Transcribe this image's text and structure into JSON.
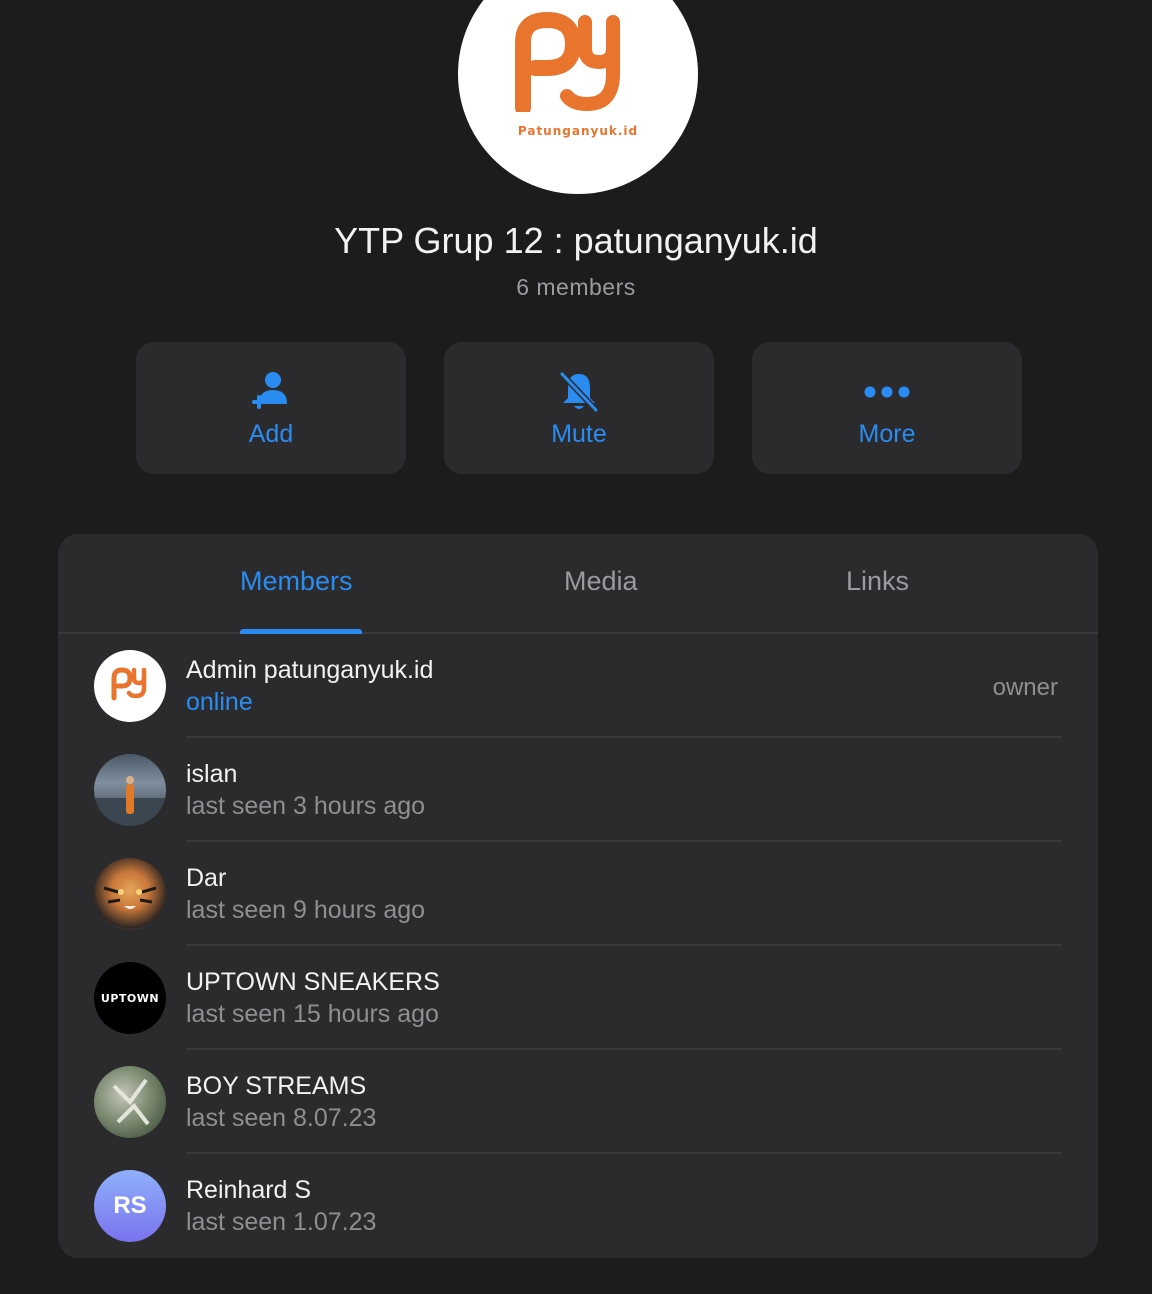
{
  "group": {
    "logo_text": "Patunganyuk.id",
    "title": "YTP Grup 12 : patunganyuk.id",
    "subtitle": "6 members"
  },
  "actions": {
    "add": {
      "label": "Add",
      "icon": "add-person-icon"
    },
    "mute": {
      "label": "Mute",
      "icon": "bell-slash-icon"
    },
    "more": {
      "label": "More",
      "icon": "ellipsis-icon"
    }
  },
  "tabs": [
    {
      "label": "Members",
      "active": true
    },
    {
      "label": "Media",
      "active": false
    },
    {
      "label": "Links",
      "active": false
    }
  ],
  "members": [
    {
      "name": "Admin patunganyuk.id",
      "status": "online",
      "role": "owner"
    },
    {
      "name": "islan",
      "status": "last seen 3 hours ago"
    },
    {
      "name": "Dar",
      "status": "last seen 9 hours ago"
    },
    {
      "name": "UPTOWN SNEAKERS",
      "status": "last seen 15 hours ago",
      "avatar_text": "UPTOWN"
    },
    {
      "name": "BOY STREAMS",
      "status": "last seen 8.07.23"
    },
    {
      "name": "Reinhard S",
      "status": "last seen 1.07.23",
      "initials": "RS"
    }
  ],
  "colors": {
    "background": "#1c1c1d",
    "card": "#2b2b2d",
    "accent": "#2a8cf0",
    "brand_orange": "#e8742e",
    "secondary_text": "#8e8e93"
  }
}
